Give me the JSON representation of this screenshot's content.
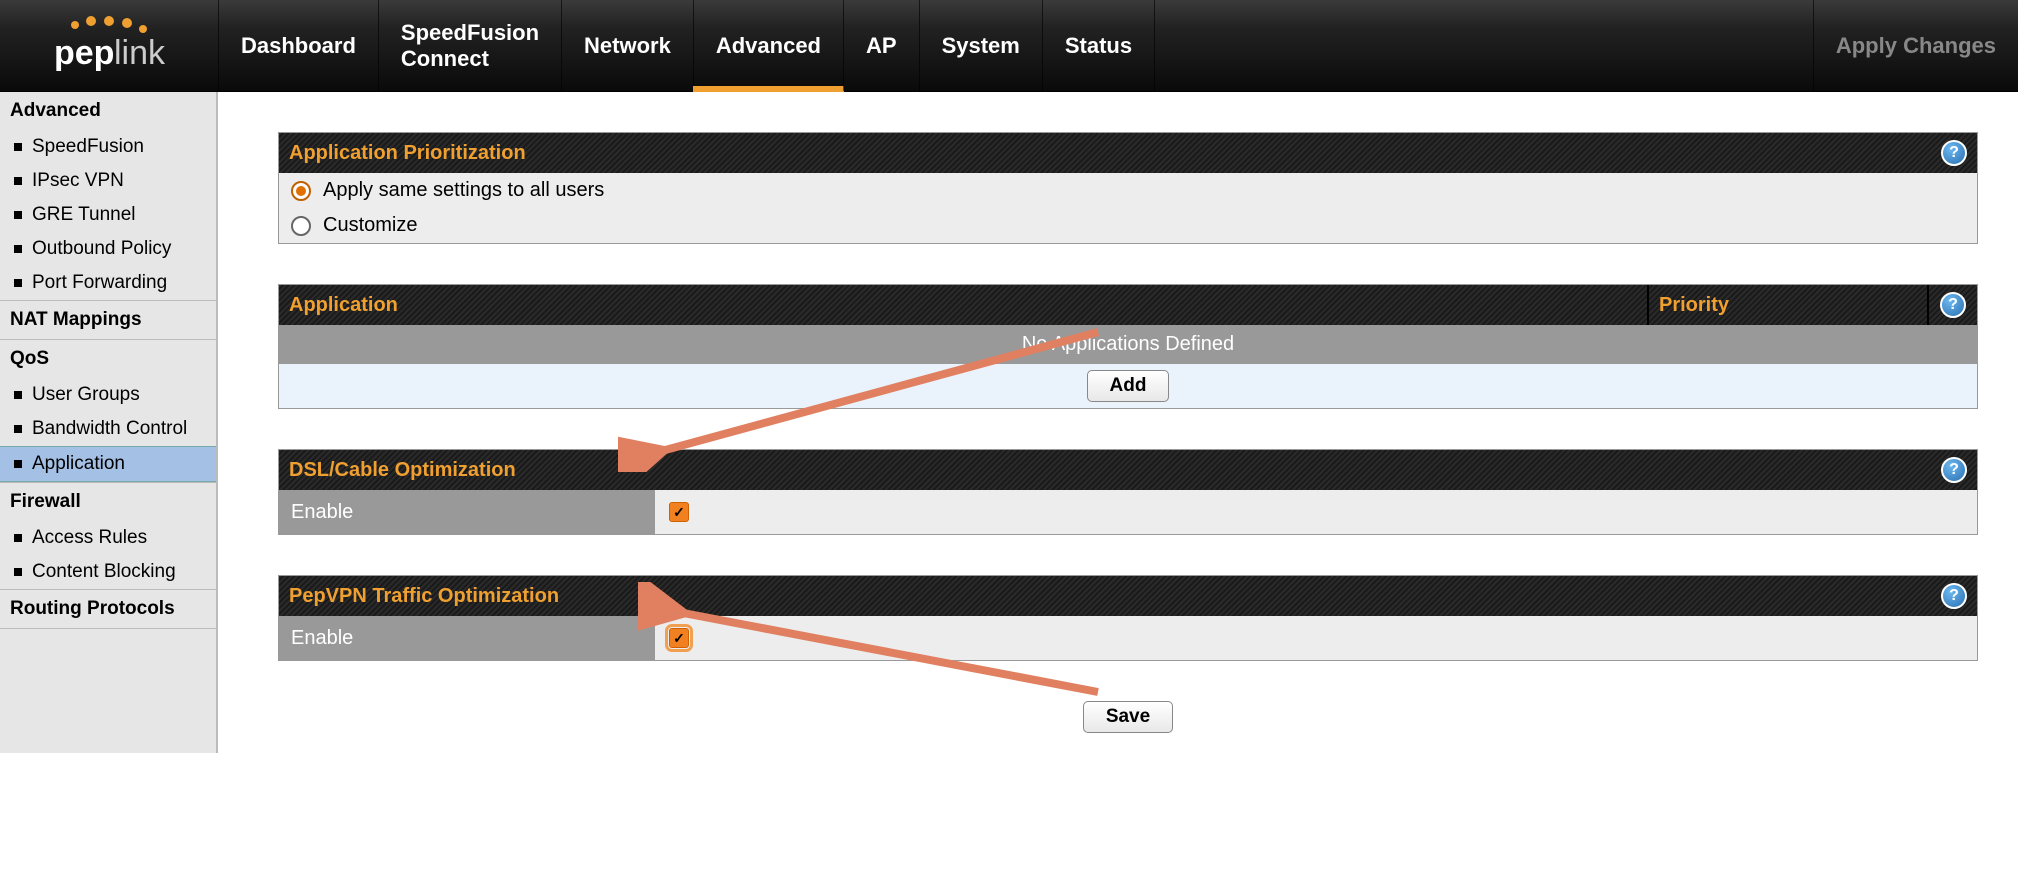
{
  "brand": "peplink",
  "topnav": {
    "items": [
      "Dashboard",
      "SpeedFusion Connect",
      "Network",
      "Advanced",
      "AP",
      "System",
      "Status"
    ],
    "active": 3,
    "apply_changes": "Apply Changes"
  },
  "sidebar": {
    "sections": [
      {
        "title": "Advanced",
        "items": [
          "SpeedFusion",
          "IPsec VPN",
          "GRE Tunnel",
          "Outbound Policy",
          "Port Forwarding"
        ],
        "active": -1
      },
      {
        "title": "NAT Mappings",
        "items": [],
        "active": -1
      },
      {
        "title": "QoS",
        "items": [
          "User Groups",
          "Bandwidth Control",
          "Application"
        ],
        "active": 2
      },
      {
        "title": "Firewall",
        "items": [
          "Access Rules",
          "Content Blocking"
        ],
        "active": -1
      },
      {
        "title": "Routing Protocols",
        "items": [],
        "active": -1
      }
    ]
  },
  "panels": {
    "prioritization": {
      "title": "Application Prioritization",
      "option_all": "Apply same settings to all users",
      "option_custom": "Customize",
      "selected": "all"
    },
    "applications": {
      "col_app": "Application",
      "col_priority": "Priority",
      "empty": "No Applications Defined",
      "add": "Add"
    },
    "dsl": {
      "title": "DSL/Cable Optimization",
      "label": "Enable",
      "checked": true
    },
    "pepvpn": {
      "title": "PepVPN Traffic Optimization",
      "label": "Enable",
      "checked": true
    },
    "save": "Save"
  }
}
